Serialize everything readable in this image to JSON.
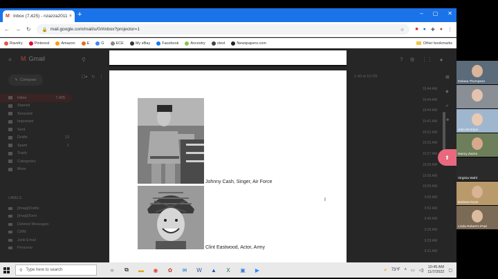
{
  "browser": {
    "tab_title": "Inbox (7,425) - nzazza2011@gm...",
    "tab_close": "×",
    "new_tab": "+",
    "url": "mail.google.com/mail/u/0/#inbox?projector=1",
    "window_minimize": "–",
    "window_maximize": "▢",
    "window_close": "✕"
  },
  "bookmarks": [
    {
      "label": "Ravelry",
      "color": "#e05a47"
    },
    {
      "label": "Pinterest",
      "color": "#e60023"
    },
    {
      "label": "Amazon",
      "color": "#ff9900"
    },
    {
      "label": "E",
      "color": "#e76b24"
    },
    {
      "label": "G",
      "color": "#4285f4"
    },
    {
      "label": "ECE",
      "color": "#888888"
    },
    {
      "label": "My eBay",
      "color": "#333333"
    },
    {
      "label": "Facebook",
      "color": "#1877f2"
    },
    {
      "label": "Ancestry",
      "color": "#8bc34a"
    },
    {
      "label": "vtext",
      "color": "#444444"
    },
    {
      "label": "Newspapers.com",
      "color": "#222222"
    }
  ],
  "bookmarks_other": "Other bookmarks",
  "gmail": {
    "logo": "Gmail",
    "compose": "Compose",
    "nav": [
      {
        "label": "Inbox",
        "count": "7,425",
        "active": true
      },
      {
        "label": "Starred",
        "count": ""
      },
      {
        "label": "Snoozed",
        "count": ""
      },
      {
        "label": "Important",
        "count": ""
      },
      {
        "label": "Sent",
        "count": ""
      },
      {
        "label": "Drafts",
        "count": "13"
      },
      {
        "label": "Spam",
        "count": "1"
      },
      {
        "label": "Trash",
        "count": ""
      },
      {
        "label": "Categories",
        "count": ""
      },
      {
        "label": "More",
        "count": ""
      }
    ],
    "labels_heading": "LABELS",
    "labels": [
      "[Imap]/Drafts",
      "[Imap]/Sent",
      "Deleted Messages",
      "CRM",
      "Junk Email",
      "Personal"
    ],
    "pager": "1–50 of 10,725",
    "times": [
      "10:44 AM",
      "10:44 AM",
      "10:44 AM",
      "10:41 AM",
      "10:31 AM",
      "10:31 AM",
      "10:27 AM",
      "10:05 AM",
      "10:05 AM",
      "10:05 AM",
      "9:55 AM",
      "9:52 AM",
      "9:45 AM",
      "9:35 AM",
      "9:33 AM",
      "9:31 AM"
    ]
  },
  "document": {
    "caption1": "Johnny Cash, Singer, Air Force",
    "caption2": "Clint Eastwood, Actor, Army"
  },
  "zoom_participants": [
    {
      "name": "Delana Thompson",
      "bg": "#5b6b7a",
      "skin": "#d9b59a"
    },
    {
      "name": "",
      "bg": "#8a8f95",
      "skin": "#e3c3ad"
    },
    {
      "name": "Julia McIntyre",
      "bg": "#9fb6cf",
      "skin": "#e8c9b3"
    },
    {
      "name": "Nancy Zazza",
      "bg": "#6d7f5a",
      "skin": "#d7a98c"
    },
    {
      "name": "Virginia Wahl",
      "bg": "#2a2a2a",
      "skin": "#2a2a2a"
    },
    {
      "name": "Barbara Ryan",
      "bg": "#b99a6a",
      "skin": "#d8b394"
    },
    {
      "name": "Linda Robert's iPad",
      "bg": "#7b6a55",
      "skin": "#dcbc9f"
    }
  ],
  "taskbar": {
    "search_placeholder": "Type here to search",
    "weather": "73°F",
    "time": "10:45 AM",
    "date": "11/7/2022"
  }
}
